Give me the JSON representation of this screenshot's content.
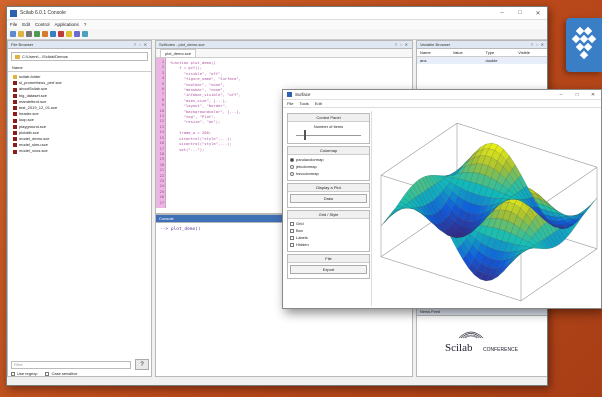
{
  "main_window": {
    "title": "Scilab 6.0.1 Console",
    "menu": [
      "File",
      "Edit",
      "Control",
      "Applications",
      "?"
    ],
    "controls": [
      "–",
      "□",
      "✕"
    ]
  },
  "file_browser": {
    "header": "File Browser",
    "path": "C:\\Users\\...\\Scilab\\Demos",
    "column": "Name",
    "root": "scilab-folder",
    "files": [
      "sl_prometheus_perf.sce",
      "aboutScilab.sce",
      "big_dataset.sce",
      "mandelbrot.sce",
      "test_2019_12_01.sce",
      "header.sce",
      "loop.sce",
      "playground.sce",
      "plotalib.sce",
      "model_demo.sce",
      "model_simu.sce",
      "model_xcos.sce"
    ],
    "filter_placeholder": "Filter",
    "filter_btn": "?",
    "check_1": "Use regexp",
    "check_2": "Case sensitive"
  },
  "editor": {
    "header": "SciNotes - plot_demo.sce",
    "tab": "plot_demo.sce",
    "line_numbers": [
      "1",
      "2",
      "3",
      "4",
      "5",
      "6",
      "7",
      "8",
      "9",
      "10",
      "11",
      "12",
      "13",
      "14",
      "15",
      "16",
      "17",
      "18",
      "19",
      "20",
      "21",
      "22",
      "23",
      "24",
      "25",
      "26",
      "27"
    ],
    "code": "function plot_demo()\n    f = gcf();\n      \"visible\", \"off\",\n      \"figure_name\", \"Surface\",\n      \"toolbar\", \"none\",\n      \"menubar\", \"none\",\n      \"infobar_visible\", \"off\",\n      \"axes_size\", [...],\n      \"layout\", \"border\",\n      \"backgroundcolor\", [...],\n      \"tag\", \"Plot\",\n      \"resize\", \"on\");\n\n    frame_w = 280;\n    uicontrol(\"style\",...);\n    uicontrol(\"style\",...);\n    set(\"...\");\n"
  },
  "console": {
    "header": "Console",
    "prompt": "--> plot_demo()"
  },
  "variable_browser": {
    "header": "Variable Browser",
    "columns": [
      "Name",
      "Value",
      "Type",
      "Visible"
    ],
    "row": [
      "ans",
      "",
      "double",
      ""
    ]
  },
  "news_feed": {
    "header": "News Feed",
    "logo_text": "Scilab",
    "logo_sub": "CONFERENCE"
  },
  "figure": {
    "title": "Surface",
    "menu": [
      "File",
      "Tools",
      "Edit"
    ],
    "controls": [
      "–",
      "□",
      "✕"
    ],
    "panel_title": "Control Panel",
    "slider_label": "Number of items",
    "colormap_title": "Colormap",
    "colormaps": [
      "parulacolormap",
      "jetcolormap",
      "hsvcolormap"
    ],
    "action_title": "Display a Plot",
    "action_btn": "Draw",
    "style_title": "Grid / Style",
    "options": [
      "Grid",
      "Box",
      "Labels",
      "Hidden"
    ],
    "export_title": "File",
    "export_btn": "Export"
  },
  "colors": {
    "background": "#c0541f",
    "console_header": "#3f6fb5",
    "gutter": "#e9b7e1",
    "logo_badge": "#3a7fc6"
  }
}
